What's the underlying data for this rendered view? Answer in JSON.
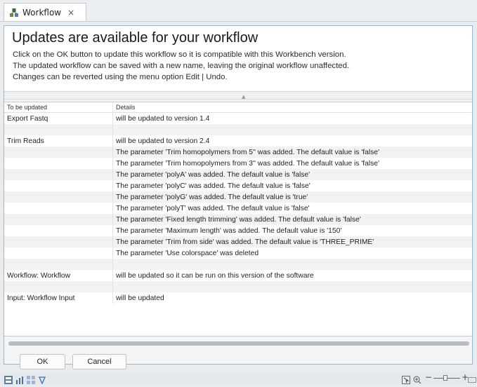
{
  "tab": {
    "title": "Workflow",
    "close": "×"
  },
  "header": {
    "title": "Updates are available for your workflow",
    "lines": [
      "Click on the OK button to update this workflow so it is compatible with this Workbench version.",
      "The updated workflow can be saved with a new name, leaving the original workflow unaffected.",
      "Changes can be reverted using the menu option Edit | Undo."
    ]
  },
  "table": {
    "columns": [
      "To be updated",
      "Details"
    ],
    "rows": [
      [
        "Export Fastq",
        "will be updated to version 1.4"
      ],
      [
        "",
        ""
      ],
      [
        "Trim Reads",
        "will be updated to version 2.4"
      ],
      [
        "",
        "The parameter 'Trim homopolymers from 5'' was added. The default value is 'false'"
      ],
      [
        "",
        "The parameter 'Trim homopolymers from 3'' was added. The default value is 'false'"
      ],
      [
        "",
        "The parameter 'polyA' was added. The default value is 'false'"
      ],
      [
        "",
        "The parameter 'polyC' was added. The default value is 'false'"
      ],
      [
        "",
        "The parameter 'polyG' was added. The default value is 'true'"
      ],
      [
        "",
        "The parameter 'polyT' was added. The default value is 'false'"
      ],
      [
        "",
        "The parameter 'Fixed length trimming' was added. The default value is 'false'"
      ],
      [
        "",
        "The parameter 'Maximum length' was added. The default value is '150'"
      ],
      [
        "",
        "The parameter 'Trim from side' was added. The default value is 'THREE_PRIME'"
      ],
      [
        "",
        "The parameter 'Use colorspace' was deleted"
      ],
      [
        "",
        ""
      ],
      [
        "Workflow: Workflow",
        "will be updated so it can be run on this version of the software"
      ],
      [
        "",
        ""
      ],
      [
        "Input: Workflow Input",
        "will be updated"
      ]
    ]
  },
  "buttons": {
    "ok": "OK",
    "cancel": "Cancel"
  },
  "statusbar": {
    "zoom_minus": "−",
    "zoom_plus": "+"
  },
  "colors": {
    "frame_border": "#9ab7cf",
    "accent": "#4a7fb5"
  }
}
